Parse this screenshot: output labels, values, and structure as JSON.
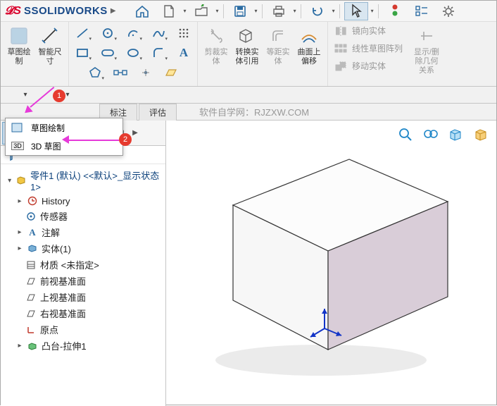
{
  "app": {
    "brand_prefix": "S",
    "brand_name": "SOLIDWORKS"
  },
  "sketch_dropdown": {
    "item1": "草图绘制",
    "item2": "3D 草图"
  },
  "ribbon": {
    "sketch": "草图绘\n制",
    "smart_dimension": "智能尺\n寸",
    "trim": "剪裁实\n体",
    "convert": "转换实\n体引用",
    "offset_surface": "等距实\n体",
    "offset_on_surface": "曲面上\n偏移",
    "mirror": "镜向实体",
    "linear_pattern": "线性草图阵列",
    "move": "移动实体",
    "display_rel": "显示/删\n除几何\n关系"
  },
  "tabs": {
    "t1": "标注",
    "t2": "评估"
  },
  "watermark": "软件自学网：RJZXW.COM",
  "tree": {
    "root": "零件1 (默认) <<默认>_显示状态 1>",
    "history": "History",
    "sensors": "传感器",
    "annotations": "注解",
    "solid_bodies": "实体(1)",
    "material": "材质 <未指定>",
    "front_plane": "前视基准面",
    "top_plane": "上视基准面",
    "right_plane": "右视基准面",
    "origin": "原点",
    "boss_extrude": "凸台-拉伸1"
  },
  "badges": {
    "b1": "1",
    "b2": "2"
  }
}
